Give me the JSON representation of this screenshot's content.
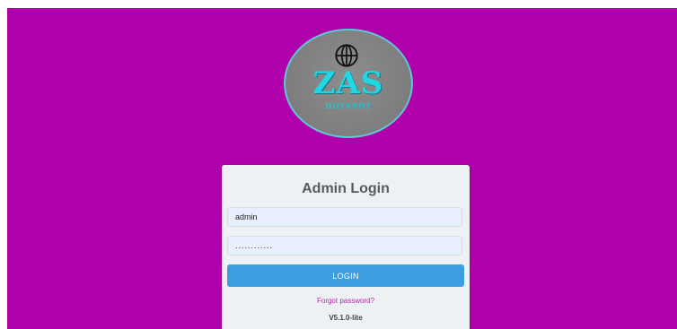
{
  "logo": {
    "brand": "ZAS",
    "subtitle": "HOTSPOT",
    "icon": "globe-icon"
  },
  "login": {
    "title": "Admin Login",
    "username_value": "admin",
    "password_value": "............",
    "button_label": "LOGIN",
    "forgot_link": "Forgot password?",
    "version": "V5.1.0-lite"
  },
  "colors": {
    "background": "#b000ab",
    "button": "#3c9ede",
    "logo_text": "#23d6e3",
    "link": "#b32cb0"
  }
}
